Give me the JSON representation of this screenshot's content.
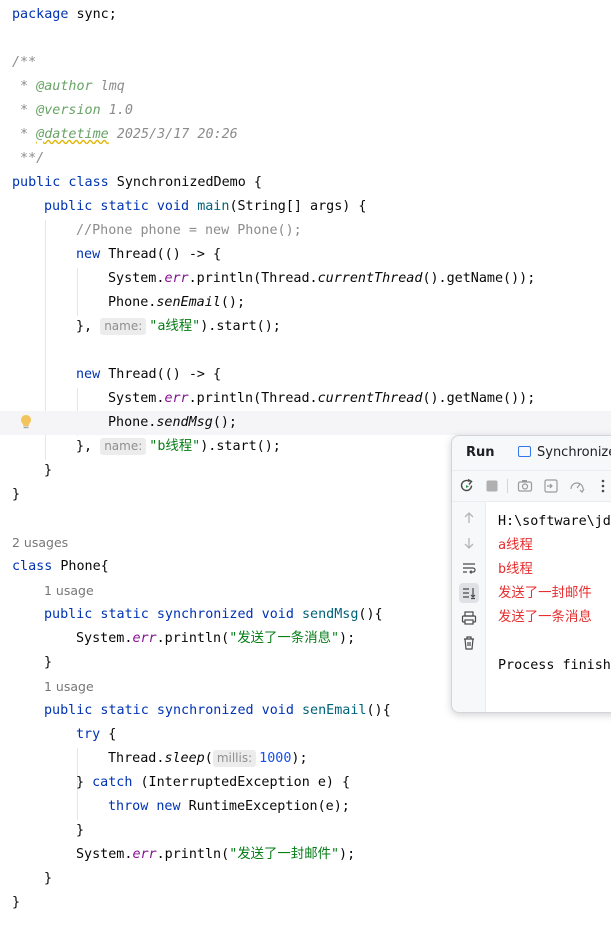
{
  "code": {
    "package_kw": "package",
    "package_name": " sync;",
    "doc_open": "/**",
    "doc_star": " * ",
    "author_tag": "@author",
    "author_val": " lmq",
    "version_tag": "@version",
    "version_val": " 1.0",
    "datetime_tag": "@datetime",
    "datetime_val": " 2025/3/17 20:26",
    "doc_close": " **/",
    "class_decl_kw": "public class",
    "class_decl_name": " SynchronizedDemo {",
    "main_kw": "public static void",
    "main_name": "main",
    "main_params": "(String[] args) {",
    "phone_comment": "//Phone phone = new Phone();",
    "new_kw": "new",
    "thread_open": " Thread(() -> {",
    "system": "System.",
    "err": "err",
    "println_thread": ".println(Thread.",
    "current_thread": "currentThread",
    "get_name": "().getName());",
    "phone_prefix": "Phone.",
    "sen_email_call": "senEmail",
    "call_end": "();",
    "send_msg_call": "sendMsg",
    "thread_close": "},",
    "name_hint": "name:",
    "str_a": "\"a线程\"",
    "str_b": "\"b线程\"",
    "start_call": ").start();",
    "close_brace": "}",
    "usages_2": "2 usages",
    "usage_1": "1 usage",
    "class_kw": "class",
    "phone_class": " Phone{",
    "method_kw": "public static synchronized void",
    "send_msg_name": "sendMsg",
    "sen_email_name": "senEmail",
    "method_sig_end": "(){",
    "println_open": ".println(",
    "str_msg": "\"发送了一条消息\"",
    "str_mail": "\"发送了一封邮件\"",
    "println_close": ");",
    "try_kw": "try",
    "try_brace": " {",
    "thread_sleep": "Thread.",
    "sleep": "sleep",
    "paren_open": "(",
    "millis_hint": "millis:",
    "millis_val": "1000",
    "catch_close": "} ",
    "catch_kw": "catch",
    "catch_sig": " (InterruptedException e) {",
    "throw_kw": "throw new",
    "throw_rest": " RuntimeException(e);"
  },
  "run_panel": {
    "title": "Run",
    "tab_label": "SynchronizedDemo",
    "console_lines": [
      {
        "text": "H:\\software\\jdk",
        "kind": "normal"
      },
      {
        "text": "a线程",
        "kind": "error"
      },
      {
        "text": "b线程",
        "kind": "error"
      },
      {
        "text": "发送了一封邮件",
        "kind": "error"
      },
      {
        "text": "发送了一条消息",
        "kind": "error"
      },
      {
        "text": "",
        "kind": "normal"
      },
      {
        "text": "Process finished",
        "kind": "normal"
      }
    ]
  },
  "colors": {
    "keyword": "#0033b3",
    "method": "#00627a",
    "string": "#067d17",
    "field": "#871094",
    "number": "#1750eb",
    "error_text": "#e62e2e",
    "doc_tag": "#67a366"
  },
  "icons": {
    "gutter": "lightbulb-icon",
    "toolbar": [
      "rerun-icon",
      "stop-icon",
      "camera-icon",
      "restore-layout-icon",
      "dashboard-icon",
      "more-icon"
    ],
    "side": [
      "up-arrow-icon",
      "down-arrow-icon",
      "soft-wrap-icon",
      "scroll-to-end-icon",
      "print-icon",
      "trash-icon"
    ]
  }
}
